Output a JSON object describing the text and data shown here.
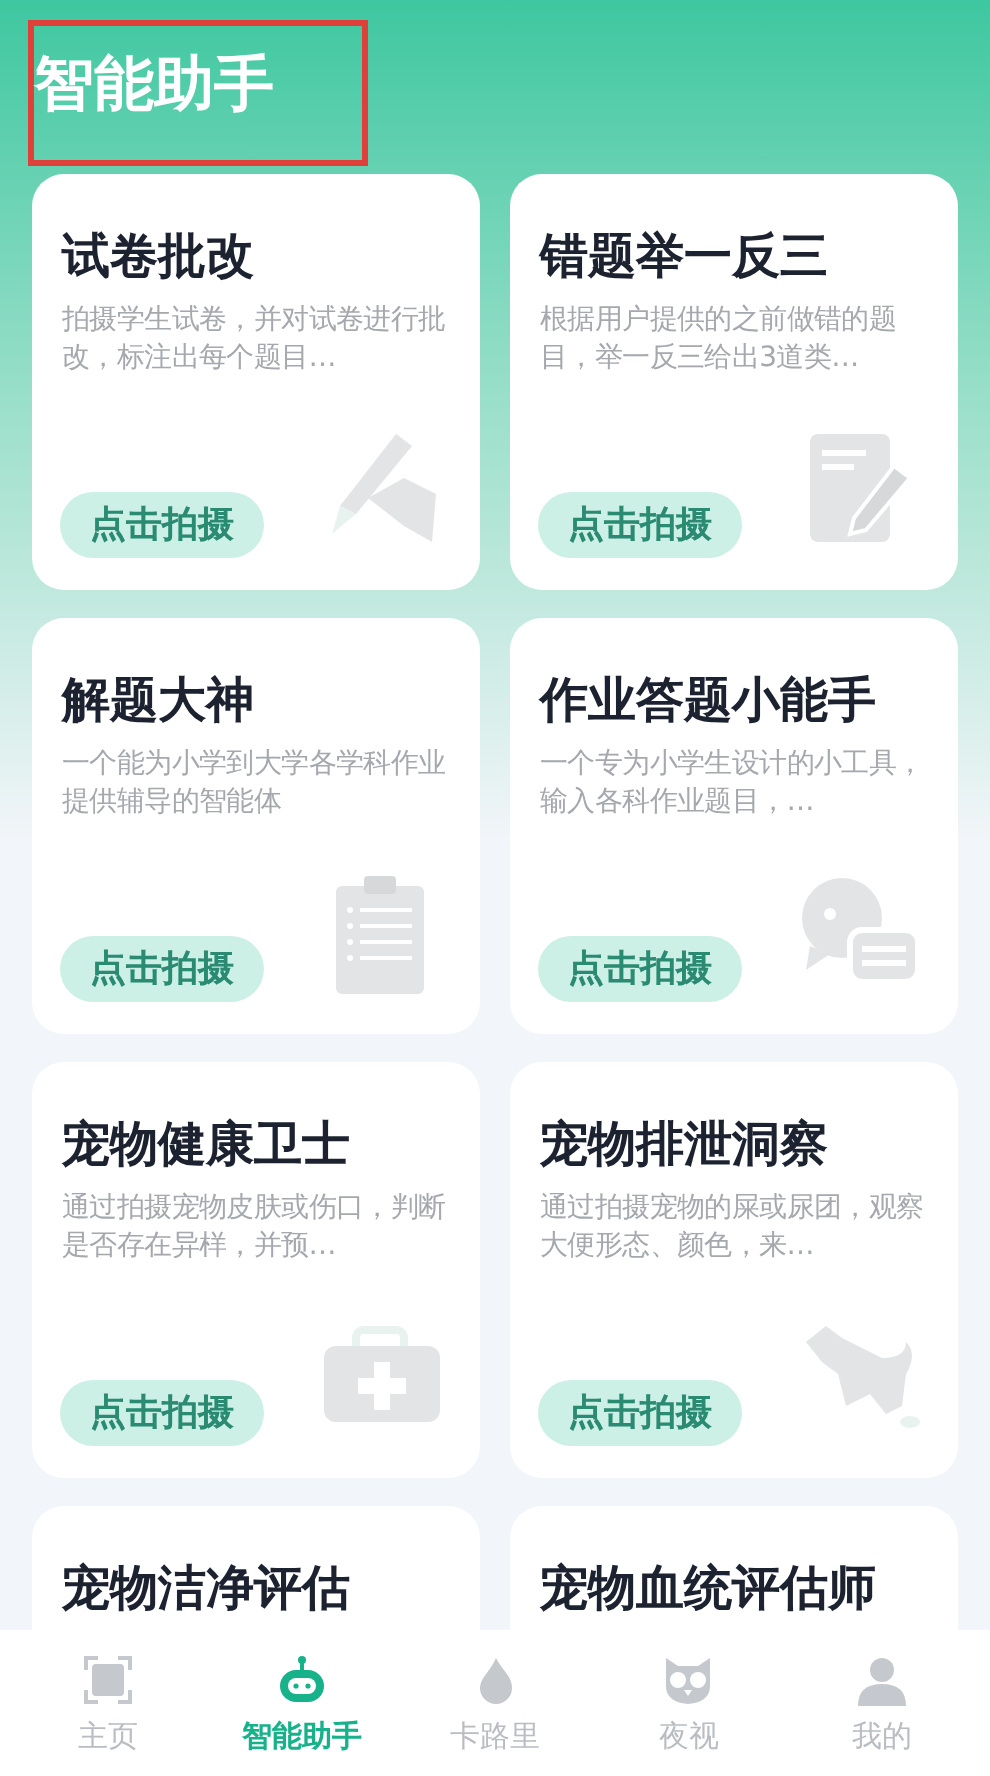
{
  "header": {
    "title": "智能助手"
  },
  "cards": [
    {
      "title": "试卷批改",
      "description": "拍摄学生试卷，并对试卷进行批改，标注出每个题目…",
      "button": "点击拍摄"
    },
    {
      "title": "错题举一反三",
      "description": "根据用户提供的之前做错的题目，举一反三给出3道类…",
      "button": "点击拍摄"
    },
    {
      "title": "解题大神",
      "description": "一个能为小学到大学各学科作业提供辅导的智能体",
      "button": "点击拍摄"
    },
    {
      "title": "作业答题小能手",
      "description": "一个专为小学生设计的小工具，输入各科作业题目，…",
      "button": "点击拍摄"
    },
    {
      "title": "宠物健康卫士",
      "description": "通过拍摄宠物皮肤或伤口，判断是否存在异样，并预…",
      "button": "点击拍摄"
    },
    {
      "title": "宠物排泄洞察",
      "description": "通过拍摄宠物的屎或尿团，观察大便形态、颜色，来…",
      "button": "点击拍摄"
    },
    {
      "title": "宠物洁净评估"
    },
    {
      "title": "宠物血统评估师"
    }
  ],
  "tabbar": [
    {
      "label": "主页",
      "selected": false
    },
    {
      "label": "智能助手",
      "selected": true
    },
    {
      "label": "卡路里",
      "selected": false
    },
    {
      "label": "夜视",
      "selected": false
    },
    {
      "label": "我的",
      "selected": false
    }
  ]
}
